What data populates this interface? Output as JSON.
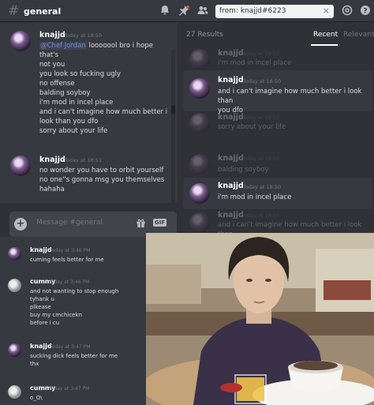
{
  "header": {
    "channel": "general",
    "search_value": "from: knajjd#6223"
  },
  "chat": {
    "messages": [
      {
        "author": "knajjd",
        "time": "Today at 18:50",
        "mention": "@Chef Jordan",
        "lines": [
          "looooool bro i hope that's",
          "not you",
          "you look so fucking ugly",
          "no offense",
          "balding soyboy",
          "i'm mod in incel place",
          "and i can't imagine how much better i",
          "look than you dfo",
          "sorry about your life"
        ]
      },
      {
        "author": "knajjd",
        "time": "Today at 18:51",
        "lines": [
          "no wonder you have to orbit yourself",
          "no one''s gonna msg you themselves",
          "hahaha"
        ]
      }
    ],
    "input_placeholder": "Message #general"
  },
  "results": {
    "count": "27 Results",
    "tab_recent": "Recent",
    "tab_relevant": "Relevant",
    "faded_items": [
      {
        "author": "knajjd",
        "time": "Today at 18:50",
        "text": "i'm mod in incel place"
      },
      {
        "author": "knajjd",
        "time": "Today at 18:50",
        "text": "sorry about your life"
      },
      {
        "author": "knajjd",
        "time": "Today at 18:50",
        "text": "balding soyboy"
      },
      {
        "author": "knajjd",
        "time": "Today at 18:50",
        "text": "and i can't imagine how much better i look than"
      }
    ],
    "cards": [
      {
        "author": "knajjd",
        "time": "Today at 18:50",
        "lines": [
          "and i can't imagine how much better i look than",
          "you dfo"
        ]
      },
      {
        "author": "knajjd",
        "time": "Today at 18:50",
        "lines": [
          "i'm mod in incel place"
        ]
      }
    ]
  },
  "lower_chat": {
    "messages": [
      {
        "author": "knajjd",
        "time": "Today at 3:46 PM",
        "lines": [
          "cuming feels better for me"
        ]
      },
      {
        "author": "cummy",
        "time": "Today at 3:46 PM",
        "lines": [
          "and not wanting to stop enough",
          "tyhank u",
          "plkease",
          "buy my cmchicekn",
          "before i cu"
        ]
      },
      {
        "author": "knajjd",
        "time": "Today at 3:47 PM",
        "lines": [
          "sucking dick feels better for me",
          "thx"
        ]
      },
      {
        "author": "cummy",
        "time": "Today at 3:47 PM",
        "lines": [
          "o_O\\"
        ]
      }
    ]
  },
  "colors": {
    "chat_bg": "#36393f",
    "panel_bg": "#2f3136",
    "accent": "#7289da"
  }
}
